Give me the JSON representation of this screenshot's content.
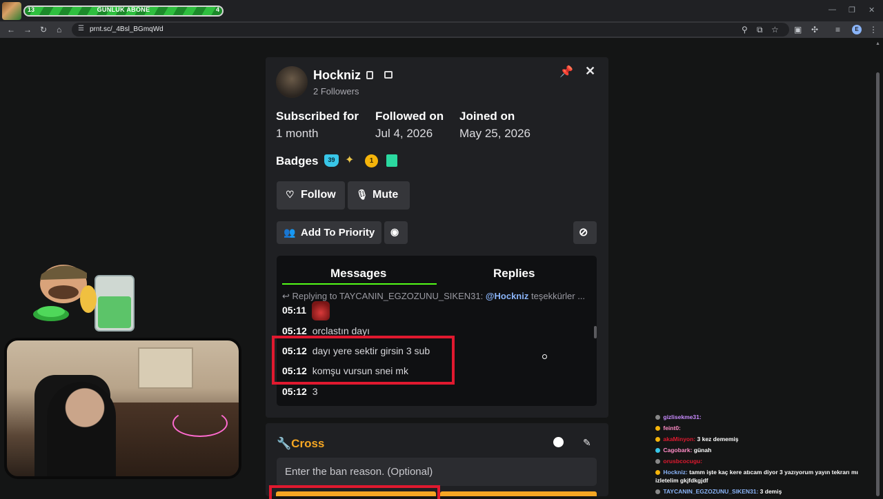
{
  "stream_overlay": {
    "sub_goal": {
      "current": "13",
      "label": "GÜNLÜK ABONE",
      "target": "4"
    }
  },
  "browser": {
    "url": "prnt.sc/_4Bsl_BGmqWd",
    "profile_initial": "E",
    "window_controls": [
      "—",
      "❐",
      "✕"
    ]
  },
  "user_card": {
    "username": "Hockniz",
    "followers": "2 Followers",
    "stats": [
      {
        "label": "Subscribed for",
        "value": "1 month"
      },
      {
        "label": "Followed on",
        "value": "Jul 4, 2026"
      },
      {
        "label": "Joined on",
        "value": "May 25, 2026"
      }
    ],
    "badges_label": "Badges",
    "badges": {
      "sub_months": "39",
      "coin": "1"
    },
    "buttons": {
      "follow": "Follow",
      "mute": "Mute",
      "priority": "Add To Priority"
    },
    "tabs": {
      "messages": "Messages",
      "replies": "Replies"
    },
    "reply_context": {
      "prefix": "↩ Replying to TAYCANIN_EGZOZUNU_SIKEN31:",
      "mention": "@Hockniz",
      "text": "teşekkürler ..."
    },
    "messages": [
      {
        "time": "05:11",
        "text": ""
      },
      {
        "time": "05:12",
        "text": "orclastın dayı"
      },
      {
        "time": "05:12",
        "text": "dayı yere sektir girsin 3 sub"
      },
      {
        "time": "05:12",
        "text": "komşu vursun snei mk"
      },
      {
        "time": "05:12",
        "text": "3"
      }
    ]
  },
  "cross_panel": {
    "title": "Cross",
    "ban_placeholder": "Enter the ban reason. (Optional)"
  },
  "chat_overlay": [
    {
      "user": "gizlisekme31:",
      "text": "",
      "color": "#c98bff"
    },
    {
      "user": "feint0:",
      "text": "",
      "color": "#ff8cc6"
    },
    {
      "user": "akaMinyon:",
      "text": "3 kez dememiş",
      "color": "#e0192f"
    },
    {
      "user": "Cagobark:",
      "text": "günah",
      "color": "#ff8cc6"
    },
    {
      "user": "orusbcocugu:",
      "text": "",
      "color": "#e0192f"
    },
    {
      "user": "Hockniz:",
      "text": "tamm işte kaç kere atıcam diyor 3 yazıyorum yayın tekrarı mı izletelim gkjfdkgjdf",
      "color": "#8ab4f8"
    },
    {
      "user": "TAYCANIN_EGZOZUNU_SIKEN31:",
      "text": "3 demiş",
      "color": "#8ab4f8"
    }
  ]
}
